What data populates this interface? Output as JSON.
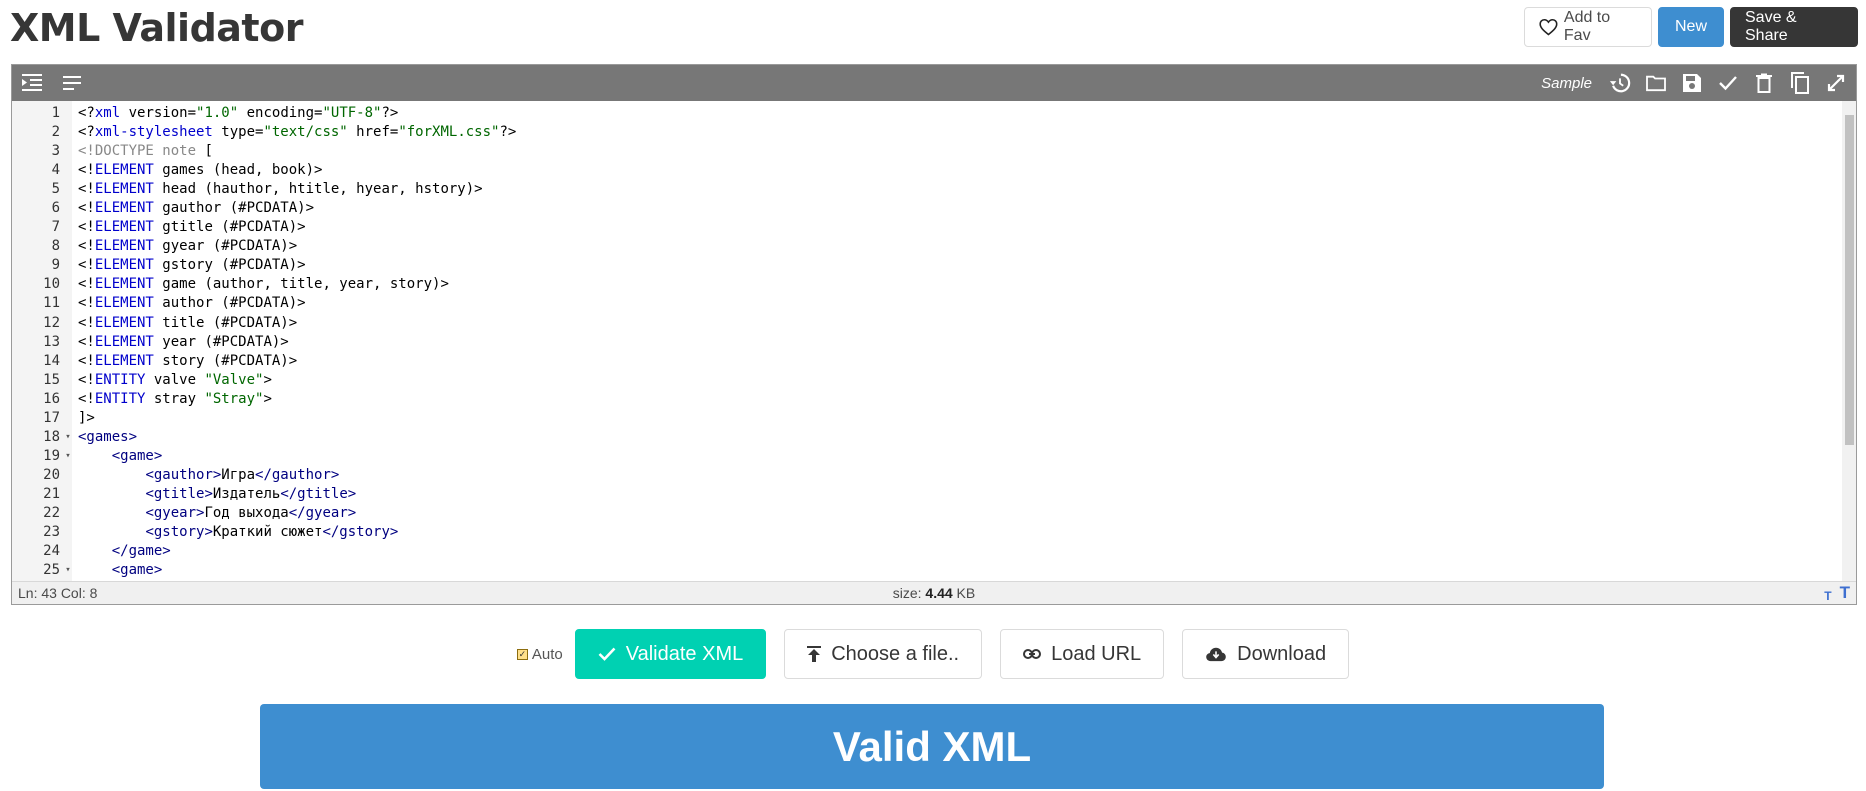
{
  "page": {
    "title": "XML Validator"
  },
  "header": {
    "fav_label": "Add to Fav",
    "new_label": "New",
    "save_label": "Save & Share"
  },
  "toolbar": {
    "sample_label": "Sample",
    "left_icons": [
      "indent-icon",
      "format-lines-icon"
    ],
    "right_icons": [
      "history-icon",
      "folder-icon",
      "save-icon",
      "check-icon",
      "trash-icon",
      "copy-icon",
      "expand-icon"
    ]
  },
  "editor": {
    "lines": [
      {
        "n": "1",
        "fold": "",
        "tokens": [
          [
            "d",
            "<?"
          ],
          [
            "k",
            "xml"
          ],
          [
            "d",
            " version="
          ],
          [
            "s",
            "\"1.0\""
          ],
          [
            "d",
            " encoding="
          ],
          [
            "s",
            "\"UTF-8\""
          ],
          [
            "d",
            "?>"
          ]
        ]
      },
      {
        "n": "2",
        "fold": "",
        "tokens": [
          [
            "d",
            "<?"
          ],
          [
            "k",
            "xml-stylesheet"
          ],
          [
            "d",
            " type="
          ],
          [
            "s",
            "\"text/css\""
          ],
          [
            "d",
            " href="
          ],
          [
            "s",
            "\"forXML.css\""
          ],
          [
            "d",
            "?>"
          ]
        ]
      },
      {
        "n": "3",
        "fold": "",
        "tokens": [
          [
            "g",
            "<!DOCTYPE note "
          ],
          [
            "d",
            "["
          ]
        ]
      },
      {
        "n": "4",
        "fold": "",
        "tokens": [
          [
            "d",
            "<!"
          ],
          [
            "k",
            "ELEMENT"
          ],
          [
            "d",
            " games (head, book)>"
          ]
        ]
      },
      {
        "n": "5",
        "fold": "",
        "tokens": [
          [
            "d",
            "<!"
          ],
          [
            "k",
            "ELEMENT"
          ],
          [
            "d",
            " head (hauthor, htitle, hyear, hstory)>"
          ]
        ]
      },
      {
        "n": "6",
        "fold": "",
        "tokens": [
          [
            "d",
            "<!"
          ],
          [
            "k",
            "ELEMENT"
          ],
          [
            "d",
            " gauthor (#PCDATA)>"
          ]
        ]
      },
      {
        "n": "7",
        "fold": "",
        "tokens": [
          [
            "d",
            "<!"
          ],
          [
            "k",
            "ELEMENT"
          ],
          [
            "d",
            " gtitle (#PCDATA)>"
          ]
        ]
      },
      {
        "n": "8",
        "fold": "",
        "tokens": [
          [
            "d",
            "<!"
          ],
          [
            "k",
            "ELEMENT"
          ],
          [
            "d",
            " gyear (#PCDATA)>"
          ]
        ]
      },
      {
        "n": "9",
        "fold": "",
        "tokens": [
          [
            "d",
            "<!"
          ],
          [
            "k",
            "ELEMENT"
          ],
          [
            "d",
            " gstory (#PCDATA)>"
          ]
        ]
      },
      {
        "n": "10",
        "fold": "",
        "tokens": [
          [
            "d",
            "<!"
          ],
          [
            "k",
            "ELEMENT"
          ],
          [
            "d",
            " game (author, title, year, story)>"
          ]
        ]
      },
      {
        "n": "11",
        "fold": "",
        "tokens": [
          [
            "d",
            "<!"
          ],
          [
            "k",
            "ELEMENT"
          ],
          [
            "d",
            " author (#PCDATA)>"
          ]
        ]
      },
      {
        "n": "12",
        "fold": "",
        "tokens": [
          [
            "d",
            "<!"
          ],
          [
            "k",
            "ELEMENT"
          ],
          [
            "d",
            " title (#PCDATA)>"
          ]
        ]
      },
      {
        "n": "13",
        "fold": "",
        "tokens": [
          [
            "d",
            "<!"
          ],
          [
            "k",
            "ELEMENT"
          ],
          [
            "d",
            " year (#PCDATA)>"
          ]
        ]
      },
      {
        "n": "14",
        "fold": "",
        "tokens": [
          [
            "d",
            "<!"
          ],
          [
            "k",
            "ELEMENT"
          ],
          [
            "d",
            " story (#PCDATA)>"
          ]
        ]
      },
      {
        "n": "15",
        "fold": "",
        "tokens": [
          [
            "d",
            "<!"
          ],
          [
            "k",
            "ENTITY"
          ],
          [
            "d",
            " valve "
          ],
          [
            "s",
            "\"Valve\""
          ],
          [
            "d",
            ">"
          ]
        ]
      },
      {
        "n": "16",
        "fold": "",
        "tokens": [
          [
            "d",
            "<!"
          ],
          [
            "k",
            "ENTITY"
          ],
          [
            "d",
            " stray "
          ],
          [
            "s",
            "\"Stray\""
          ],
          [
            "d",
            ">"
          ]
        ]
      },
      {
        "n": "17",
        "fold": "",
        "tokens": [
          [
            "d",
            "]>"
          ]
        ]
      },
      {
        "n": "18",
        "fold": "▾",
        "tokens": [
          [
            "t",
            "<games>"
          ]
        ]
      },
      {
        "n": "19",
        "fold": "▾",
        "tokens": [
          [
            "d",
            "    "
          ],
          [
            "t",
            "<game>"
          ]
        ]
      },
      {
        "n": "20",
        "fold": "",
        "tokens": [
          [
            "d",
            "        "
          ],
          [
            "t",
            "<gauthor>"
          ],
          [
            "d",
            "Игра"
          ],
          [
            "t",
            "</gauthor>"
          ]
        ]
      },
      {
        "n": "21",
        "fold": "",
        "tokens": [
          [
            "d",
            "        "
          ],
          [
            "t",
            "<gtitle>"
          ],
          [
            "d",
            "Издатель"
          ],
          [
            "t",
            "</gtitle>"
          ]
        ]
      },
      {
        "n": "22",
        "fold": "",
        "tokens": [
          [
            "d",
            "        "
          ],
          [
            "t",
            "<gyear>"
          ],
          [
            "d",
            "Год выхода"
          ],
          [
            "t",
            "</gyear>"
          ]
        ]
      },
      {
        "n": "23",
        "fold": "",
        "tokens": [
          [
            "d",
            "        "
          ],
          [
            "t",
            "<gstory>"
          ],
          [
            "d",
            "Краткий сюжет"
          ],
          [
            "t",
            "</gstory>"
          ]
        ]
      },
      {
        "n": "24",
        "fold": "",
        "tokens": [
          [
            "d",
            "    "
          ],
          [
            "t",
            "</game>"
          ]
        ]
      },
      {
        "n": "25",
        "fold": "▾",
        "tokens": [
          [
            "d",
            "    "
          ],
          [
            "t",
            "<game>"
          ]
        ]
      }
    ]
  },
  "statusbar": {
    "position": "Ln: 43 Col: 8",
    "size_label": "size: ",
    "size_value": "4.44",
    "size_unit": " KB"
  },
  "actions": {
    "auto_label": "Auto",
    "auto_checked": true,
    "validate_label": "Validate XML",
    "choose_label": "Choose a file..",
    "load_url_label": "Load URL",
    "download_label": "Download"
  },
  "result": {
    "message": "Valid XML"
  },
  "colors": {
    "primary": "#3e8ed0",
    "success": "#00d1b2",
    "dark": "#363636",
    "toolbar": "#777777"
  }
}
